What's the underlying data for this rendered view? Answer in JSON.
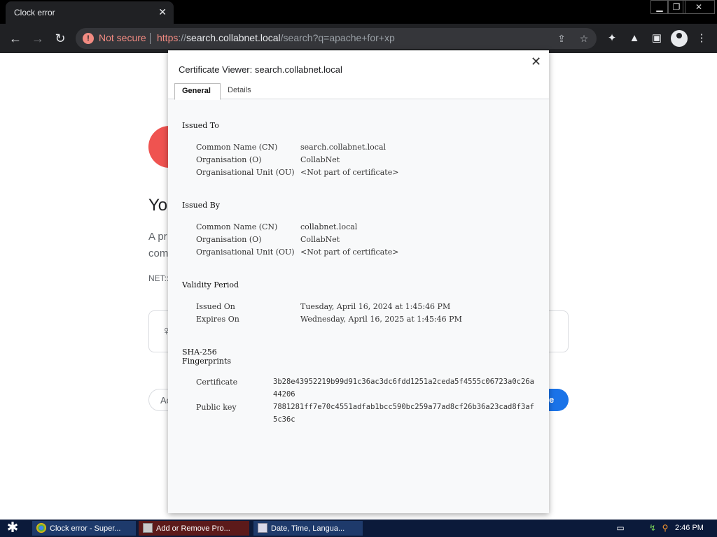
{
  "browser": {
    "tab_title": "Clock error",
    "tab_close": "✕",
    "window_controls": {
      "minimize": "▁",
      "maximize": "❐",
      "close": "✕"
    },
    "nav": {
      "back": "←",
      "forward": "→",
      "reload": "↻"
    },
    "omnibox": {
      "security_label": "Not secure",
      "url_scheme": "https",
      "url_sep": "://",
      "url_host": "search.collabnet.local",
      "url_path": "/search?q=apache+for+xp",
      "share_icon": "⇪",
      "bookmark_icon": "☆"
    },
    "toolbar_icons": {
      "extensions": "✦",
      "labs": "▲",
      "sidepanel": "▣",
      "menu": "⋮"
    }
  },
  "page": {
    "heading": "Yo",
    "text_line1": "A pr",
    "text_line2": "com",
    "net_error": "NET::",
    "box_icon": "♀",
    "advanced_label": "Ac",
    "back_label": "ne"
  },
  "dialog": {
    "title": "Certificate Viewer: search.collabnet.local",
    "close": "✕",
    "tabs": [
      {
        "label": "General"
      },
      {
        "label": "Details"
      }
    ],
    "issued_to": {
      "title": "Issued To",
      "cn_label": "Common Name (CN)",
      "cn_value": "search.collabnet.local",
      "o_label": "Organisation (O)",
      "o_value": "CollabNet",
      "ou_label": "Organisational Unit (OU)",
      "ou_value": "<Not part of certificate>"
    },
    "issued_by": {
      "title": "Issued By",
      "cn_label": "Common Name (CN)",
      "cn_value": "collabnet.local",
      "o_label": "Organisation (O)",
      "o_value": "CollabNet",
      "ou_label": "Organisational Unit (OU)",
      "ou_value": "<Not part of certificate>"
    },
    "validity": {
      "title": "Validity Period",
      "issued_label": "Issued On",
      "issued_value": "Tuesday, April 16, 2024 at 1:45:46 PM",
      "expires_label": "Expires On",
      "expires_value": "Wednesday, April 16, 2025 at 1:45:46 PM"
    },
    "fingerprints": {
      "title_line1": "SHA-256",
      "title_line2": "Fingerprints",
      "cert_label": "Certificate",
      "cert_value": "3b28e43952219b99d91c36ac3dc6fdd1251a2ceda5f4555c06723a0c26a44206",
      "key_label": "Public key",
      "key_value": "7881281ff7e70c4551adfab1bcc590bc259a77ad8cf26b36a23cad8f3af5c36c"
    }
  },
  "taskbar": {
    "start_icon": "✱",
    "items": [
      {
        "label": "Clock error - Super..."
      },
      {
        "label": "Add or Remove Pro..."
      },
      {
        "label": "Date, Time, Langua..."
      }
    ],
    "tray": {
      "keyboard": "▭",
      "network": "↯",
      "search": "⚲"
    },
    "clock": "2:46 PM"
  },
  "colors": {
    "warning": "#f28b82",
    "accent": "#1a73e8",
    "taskbar": "#0b1a3a"
  }
}
